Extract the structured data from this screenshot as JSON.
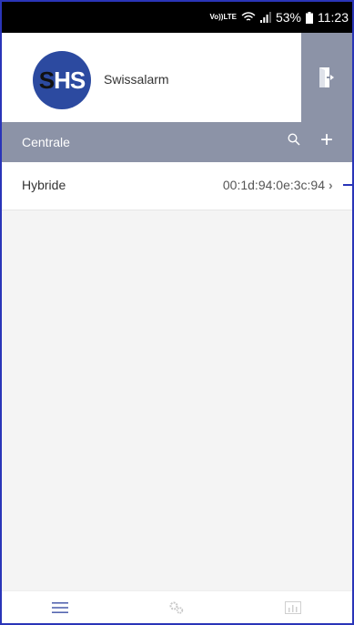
{
  "status_bar": {
    "volte_line1": "Vo))",
    "volte_line2": "LTE",
    "battery_percent": "53%",
    "time": "11:23",
    "icons": [
      "volte-icon",
      "wifi-icon",
      "signal-icon",
      "battery-icon"
    ]
  },
  "header": {
    "logo_s": "S",
    "logo_hs": "HS",
    "brand_name": "Swissalarm",
    "logout_icon": "logout-door-icon"
  },
  "section": {
    "title": "Centrale",
    "search_icon": "search-icon",
    "add_label": "+"
  },
  "devices": [
    {
      "name": "Hybride",
      "mac": "00:1d:94:0e:3c:94",
      "chevron": "›"
    }
  ],
  "tabbar": {
    "items": [
      "menu-icon",
      "settings-gears-icon",
      "chart-icon"
    ]
  },
  "colors": {
    "accent": "#8c93a7",
    "logo_bg": "#2c4aa0",
    "frame_border": "#2a35b8"
  }
}
